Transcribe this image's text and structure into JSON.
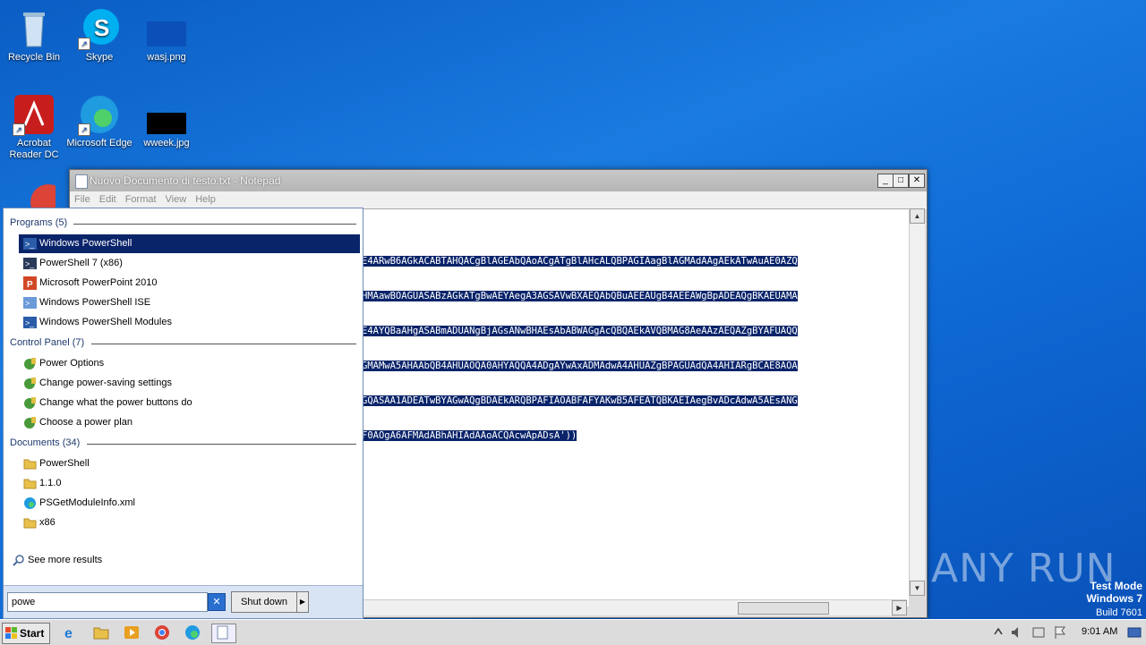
{
  "desktop": {
    "icons": [
      {
        "label": "Recycle Bin"
      },
      {
        "label": "Skype"
      },
      {
        "label": "wasj.png"
      },
      {
        "label": "Acrobat\nReader DC"
      },
      {
        "label": "Microsoft Edge"
      },
      {
        "label": "wweek.jpg"
      }
    ]
  },
  "notepad": {
    "title": "Nuovo Documento di testo.txt - Notepad",
    "menu": [
      "File",
      "Edit",
      "Format",
      "View",
      "Help"
    ],
    "lines": [
      "E4ARwB6AGkACABTAHQACgBlAGEAbQAoACgATgBlAHcALQBPAGIAagBlAGMAdAAgAEkATwAuAE0AZQ",
      "HMAawBOAGUASABzAGkATgBwAEYAegA3AGSAVwBXAEQAbQBuAEEAUgB4AEEAWgBpADEAQgBKAEUAMA",
      "E4AYQBaAHgASABmADUANgBjAGsANwBHAEsAbABWAGgAcQBQAEkAVQBMAG8AeAAzAEQAZgBYAFUAQQ",
      "GMAMwA5AHAAbQB4AHUAOQA0AHYAQQA4ADgAYwAxADMAdwA4AHUAZgBPAGUAdQA4AHIARgBCAE8AOA",
      "GQASAA1ADEATwBYAGwAQgBDAEkARQBPAFIAOABFAFYAKwB5AFEATQBKAEIAegBvADcAdwA5AEsANG",
      "F0AOgA6AFMAdABhAHIAdAAoACQAcwApADsA'))"
    ],
    "controls": {
      "minimize": "_",
      "maximize": "□",
      "close": "✕"
    }
  },
  "start_menu": {
    "programs_header": "Programs (5)",
    "programs": [
      {
        "label": "Windows PowerShell",
        "icon": "powershell-icon",
        "selected": true
      },
      {
        "label": "PowerShell 7 (x86)",
        "icon": "powershell-icon"
      },
      {
        "label": "Microsoft PowerPoint 2010",
        "icon": "powerpoint-icon"
      },
      {
        "label": "Windows PowerShell ISE",
        "icon": "powershell-ise-icon"
      },
      {
        "label": "Windows PowerShell Modules",
        "icon": "powershell-icon"
      }
    ],
    "control_panel_header": "Control Panel (7)",
    "control_panel": [
      {
        "label": "Power Options"
      },
      {
        "label": "Change power-saving settings"
      },
      {
        "label": "Change what the power buttons do"
      },
      {
        "label": "Choose a power plan"
      }
    ],
    "documents_header": "Documents (34)",
    "documents": [
      {
        "label": "PowerShell",
        "icon": "folder-icon"
      },
      {
        "label": "1.1.0",
        "icon": "folder-icon"
      },
      {
        "label": "PSGetModuleInfo.xml",
        "icon": "edge-icon"
      },
      {
        "label": "x86",
        "icon": "folder-icon"
      }
    ],
    "see_more": "See more results",
    "search_value": "powe",
    "shutdown_label": "Shut down"
  },
  "taskbar": {
    "start_label": "Start",
    "time": "9:01 AM"
  },
  "watermark": {
    "line1": "Test Mode",
    "line2": "Windows 7",
    "line3": "Build 7601",
    "brand": "ANY RUN"
  },
  "colors": {
    "desktop": "#1a7be0",
    "selection": "#0a246a"
  }
}
